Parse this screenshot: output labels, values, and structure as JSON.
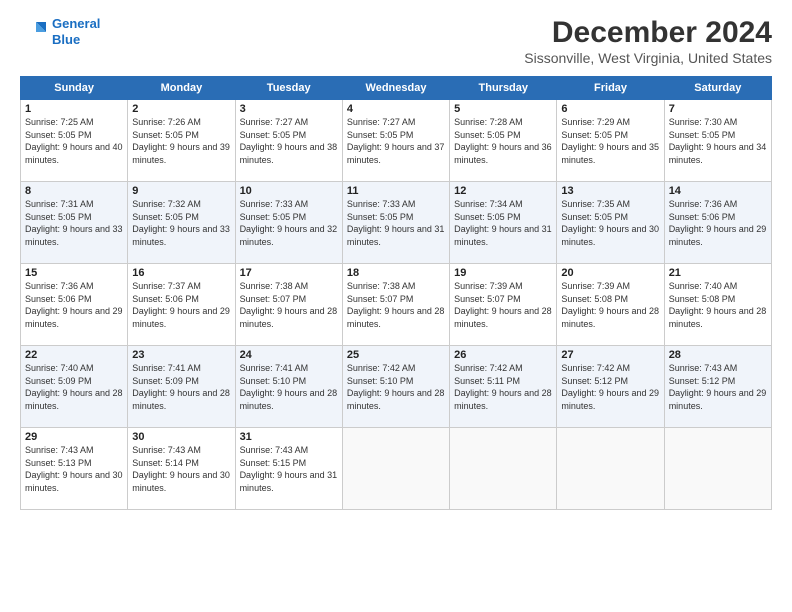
{
  "logo": {
    "line1": "General",
    "line2": "Blue"
  },
  "title": "December 2024",
  "subtitle": "Sissonville, West Virginia, United States",
  "days_header": [
    "Sunday",
    "Monday",
    "Tuesday",
    "Wednesday",
    "Thursday",
    "Friday",
    "Saturday"
  ],
  "weeks": [
    [
      {
        "day": "1",
        "sunrise": "Sunrise: 7:25 AM",
        "sunset": "Sunset: 5:05 PM",
        "daylight": "Daylight: 9 hours and 40 minutes."
      },
      {
        "day": "2",
        "sunrise": "Sunrise: 7:26 AM",
        "sunset": "Sunset: 5:05 PM",
        "daylight": "Daylight: 9 hours and 39 minutes."
      },
      {
        "day": "3",
        "sunrise": "Sunrise: 7:27 AM",
        "sunset": "Sunset: 5:05 PM",
        "daylight": "Daylight: 9 hours and 38 minutes."
      },
      {
        "day": "4",
        "sunrise": "Sunrise: 7:27 AM",
        "sunset": "Sunset: 5:05 PM",
        "daylight": "Daylight: 9 hours and 37 minutes."
      },
      {
        "day": "5",
        "sunrise": "Sunrise: 7:28 AM",
        "sunset": "Sunset: 5:05 PM",
        "daylight": "Daylight: 9 hours and 36 minutes."
      },
      {
        "day": "6",
        "sunrise": "Sunrise: 7:29 AM",
        "sunset": "Sunset: 5:05 PM",
        "daylight": "Daylight: 9 hours and 35 minutes."
      },
      {
        "day": "7",
        "sunrise": "Sunrise: 7:30 AM",
        "sunset": "Sunset: 5:05 PM",
        "daylight": "Daylight: 9 hours and 34 minutes."
      }
    ],
    [
      {
        "day": "8",
        "sunrise": "Sunrise: 7:31 AM",
        "sunset": "Sunset: 5:05 PM",
        "daylight": "Daylight: 9 hours and 33 minutes."
      },
      {
        "day": "9",
        "sunrise": "Sunrise: 7:32 AM",
        "sunset": "Sunset: 5:05 PM",
        "daylight": "Daylight: 9 hours and 33 minutes."
      },
      {
        "day": "10",
        "sunrise": "Sunrise: 7:33 AM",
        "sunset": "Sunset: 5:05 PM",
        "daylight": "Daylight: 9 hours and 32 minutes."
      },
      {
        "day": "11",
        "sunrise": "Sunrise: 7:33 AM",
        "sunset": "Sunset: 5:05 PM",
        "daylight": "Daylight: 9 hours and 31 minutes."
      },
      {
        "day": "12",
        "sunrise": "Sunrise: 7:34 AM",
        "sunset": "Sunset: 5:05 PM",
        "daylight": "Daylight: 9 hours and 31 minutes."
      },
      {
        "day": "13",
        "sunrise": "Sunrise: 7:35 AM",
        "sunset": "Sunset: 5:05 PM",
        "daylight": "Daylight: 9 hours and 30 minutes."
      },
      {
        "day": "14",
        "sunrise": "Sunrise: 7:36 AM",
        "sunset": "Sunset: 5:06 PM",
        "daylight": "Daylight: 9 hours and 29 minutes."
      }
    ],
    [
      {
        "day": "15",
        "sunrise": "Sunrise: 7:36 AM",
        "sunset": "Sunset: 5:06 PM",
        "daylight": "Daylight: 9 hours and 29 minutes."
      },
      {
        "day": "16",
        "sunrise": "Sunrise: 7:37 AM",
        "sunset": "Sunset: 5:06 PM",
        "daylight": "Daylight: 9 hours and 29 minutes."
      },
      {
        "day": "17",
        "sunrise": "Sunrise: 7:38 AM",
        "sunset": "Sunset: 5:07 PM",
        "daylight": "Daylight: 9 hours and 28 minutes."
      },
      {
        "day": "18",
        "sunrise": "Sunrise: 7:38 AM",
        "sunset": "Sunset: 5:07 PM",
        "daylight": "Daylight: 9 hours and 28 minutes."
      },
      {
        "day": "19",
        "sunrise": "Sunrise: 7:39 AM",
        "sunset": "Sunset: 5:07 PM",
        "daylight": "Daylight: 9 hours and 28 minutes."
      },
      {
        "day": "20",
        "sunrise": "Sunrise: 7:39 AM",
        "sunset": "Sunset: 5:08 PM",
        "daylight": "Daylight: 9 hours and 28 minutes."
      },
      {
        "day": "21",
        "sunrise": "Sunrise: 7:40 AM",
        "sunset": "Sunset: 5:08 PM",
        "daylight": "Daylight: 9 hours and 28 minutes."
      }
    ],
    [
      {
        "day": "22",
        "sunrise": "Sunrise: 7:40 AM",
        "sunset": "Sunset: 5:09 PM",
        "daylight": "Daylight: 9 hours and 28 minutes."
      },
      {
        "day": "23",
        "sunrise": "Sunrise: 7:41 AM",
        "sunset": "Sunset: 5:09 PM",
        "daylight": "Daylight: 9 hours and 28 minutes."
      },
      {
        "day": "24",
        "sunrise": "Sunrise: 7:41 AM",
        "sunset": "Sunset: 5:10 PM",
        "daylight": "Daylight: 9 hours and 28 minutes."
      },
      {
        "day": "25",
        "sunrise": "Sunrise: 7:42 AM",
        "sunset": "Sunset: 5:10 PM",
        "daylight": "Daylight: 9 hours and 28 minutes."
      },
      {
        "day": "26",
        "sunrise": "Sunrise: 7:42 AM",
        "sunset": "Sunset: 5:11 PM",
        "daylight": "Daylight: 9 hours and 28 minutes."
      },
      {
        "day": "27",
        "sunrise": "Sunrise: 7:42 AM",
        "sunset": "Sunset: 5:12 PM",
        "daylight": "Daylight: 9 hours and 29 minutes."
      },
      {
        "day": "28",
        "sunrise": "Sunrise: 7:43 AM",
        "sunset": "Sunset: 5:12 PM",
        "daylight": "Daylight: 9 hours and 29 minutes."
      }
    ],
    [
      {
        "day": "29",
        "sunrise": "Sunrise: 7:43 AM",
        "sunset": "Sunset: 5:13 PM",
        "daylight": "Daylight: 9 hours and 30 minutes."
      },
      {
        "day": "30",
        "sunrise": "Sunrise: 7:43 AM",
        "sunset": "Sunset: 5:14 PM",
        "daylight": "Daylight: 9 hours and 30 minutes."
      },
      {
        "day": "31",
        "sunrise": "Sunrise: 7:43 AM",
        "sunset": "Sunset: 5:15 PM",
        "daylight": "Daylight: 9 hours and 31 minutes."
      },
      null,
      null,
      null,
      null
    ]
  ]
}
